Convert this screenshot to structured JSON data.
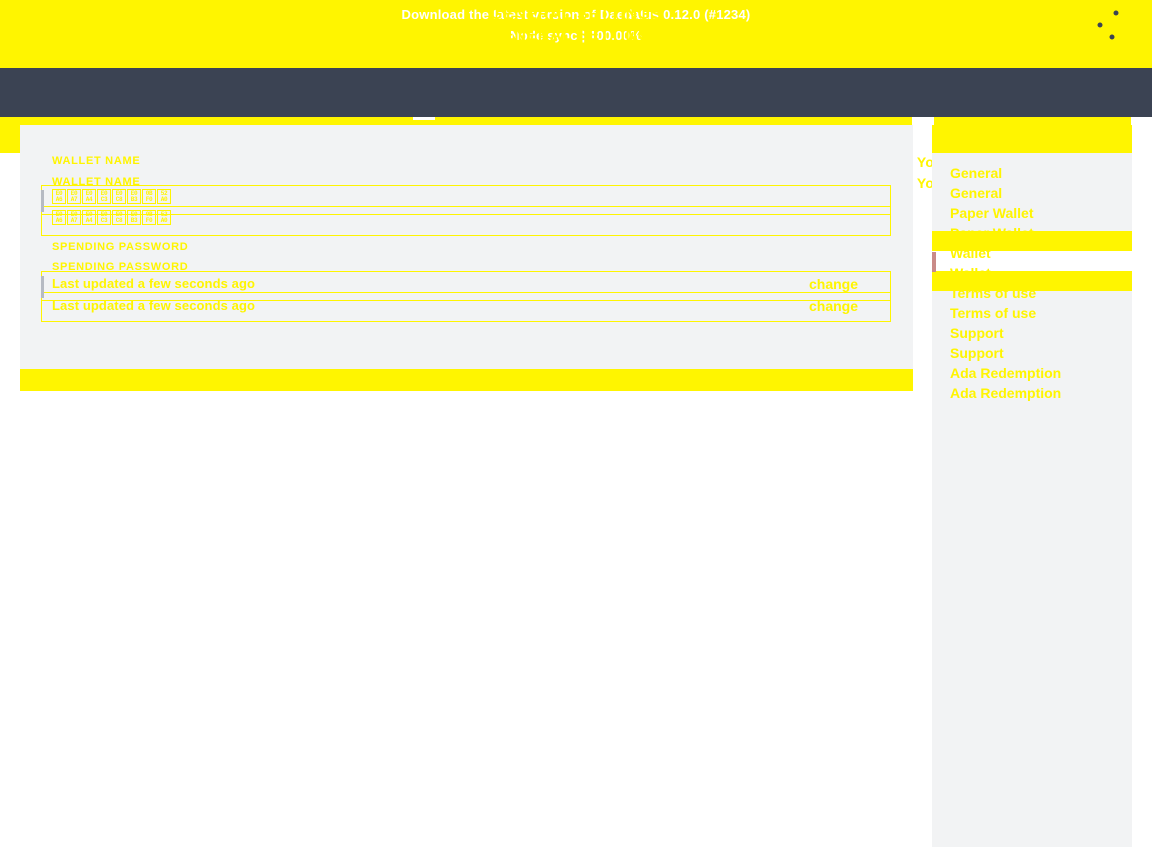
{
  "top_banner": {
    "line1": "Download the latest version of Daedalus 0.12.0 (#1234)",
    "line2": "Node sync | 100.00%"
  },
  "topbar": {
    "title": "GENERAL SETTINGS",
    "title_ghost": "GENERAL SETTINGS",
    "logo_icon": "daedalus-chevron-logo",
    "wallets_icon": "wallets-icon",
    "settings_icon": "settings-sliders-icon"
  },
  "settings": {
    "wallet_name_label": "WALLET NAME",
    "wallet_name_label_ghost": "WALLET NAME",
    "wallet_name_value_glyphs": [
      "E0A6",
      "E0A7",
      "E0A4",
      "E0C3",
      "E0C8",
      "E0B3",
      "0BF0",
      "52A0"
    ],
    "spending_password_label": "SPENDING PASSWORD",
    "spending_password_label_ghost": "SPENDING PASSWORD",
    "last_updated": "Last updated a few seconds ago",
    "last_updated_ghost": "Last updated a few seconds ago",
    "change_link": "change",
    "change_link_ghost": "change",
    "saved_message": "Your changes have been saved",
    "saved_message_ghost": "Your changes have been saved"
  },
  "sidebar": {
    "items": [
      {
        "label": "General",
        "active": false
      },
      {
        "label": "General",
        "active": false
      },
      {
        "label": "Paper Wallet",
        "active": false
      },
      {
        "label": "Paper Wallet",
        "active": false
      },
      {
        "label": "Wallet",
        "active": true
      },
      {
        "label": "Wallet",
        "active": true
      },
      {
        "label": "Terms of use",
        "active": false
      },
      {
        "label": "Terms of use",
        "active": false
      },
      {
        "label": "Support",
        "active": false
      },
      {
        "label": "Support",
        "active": false
      },
      {
        "label": "Ada Redemption",
        "active": false
      },
      {
        "label": "Ada Redemption",
        "active": false
      }
    ]
  },
  "colors": {
    "accent_yellow": "#fff500",
    "topbar_dark": "#3b4353",
    "panel_gray": "#f2f3f4",
    "active_accent": "#c98b88"
  }
}
